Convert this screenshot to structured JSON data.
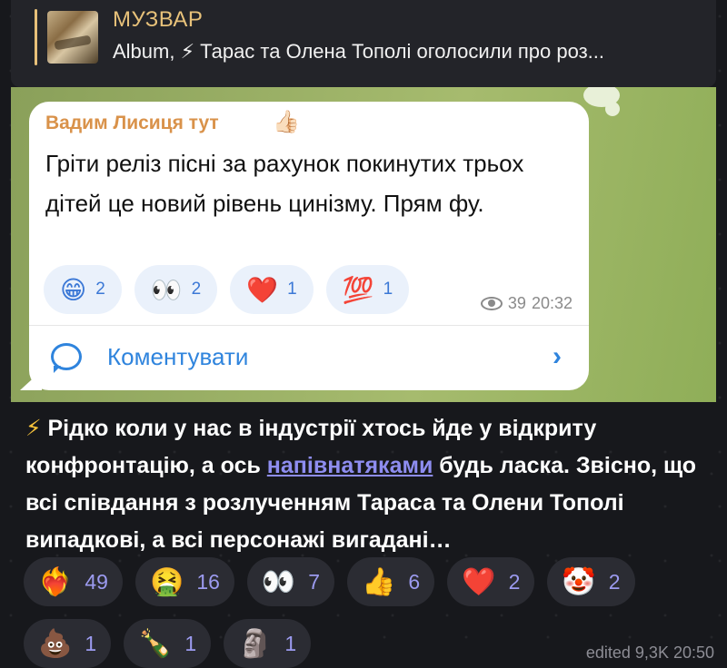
{
  "reply": {
    "channel": "МУЗВАР",
    "preview": "Album, ⚡ Тарас та Олена Тополі оголосили про роз..."
  },
  "comment_card": {
    "author": "Вадим Лисиця тут",
    "author_emoji": "👍🏻",
    "text": "Гріти реліз пісні за рахунок покинутих трьох дітей це новий рівень цинізму. Прям фу.",
    "reactions": [
      {
        "emoji": "😁",
        "count": "2"
      },
      {
        "emoji": "👀",
        "count": "2"
      },
      {
        "emoji": "❤️",
        "count": "1"
      },
      {
        "emoji": "💯",
        "count": "1"
      }
    ],
    "views": "39",
    "time": "20:32",
    "comment_label": "Коментувати"
  },
  "message": {
    "prefix": "⚡",
    "text_before_link": " Рідко коли у нас в індустрії хтось йде у відкриту конфронтацію, а ось ",
    "link_text": "напівнатяками",
    "text_after_link": " будь ласка. Звісно, що всі співдання з розлученням Тараса та Олени Тополі випадкові, а всі персонажі вигадані…"
  },
  "reactions": [
    {
      "emoji": "❤️‍🔥",
      "count": "49"
    },
    {
      "emoji": "🤮",
      "count": "16"
    },
    {
      "emoji": "👀",
      "count": "7"
    },
    {
      "emoji": "👍",
      "count": "6"
    },
    {
      "emoji": "❤️",
      "count": "2"
    },
    {
      "emoji": "🤡",
      "count": "2"
    },
    {
      "emoji": "💩",
      "count": "1"
    },
    {
      "emoji": "🍾",
      "count": "1"
    },
    {
      "emoji": "🗿",
      "count": "1"
    }
  ],
  "status": "edited 9,3K 20:50",
  "icons": {
    "comment": "speech-bubble-icon",
    "views": "eye-icon",
    "open": "chevron-right-icon"
  },
  "colors": {
    "accent_blue": "#2f84dd",
    "channel_gold": "#e8c27a",
    "author_orange": "#d9924a",
    "link_purple": "#8e8df0"
  }
}
